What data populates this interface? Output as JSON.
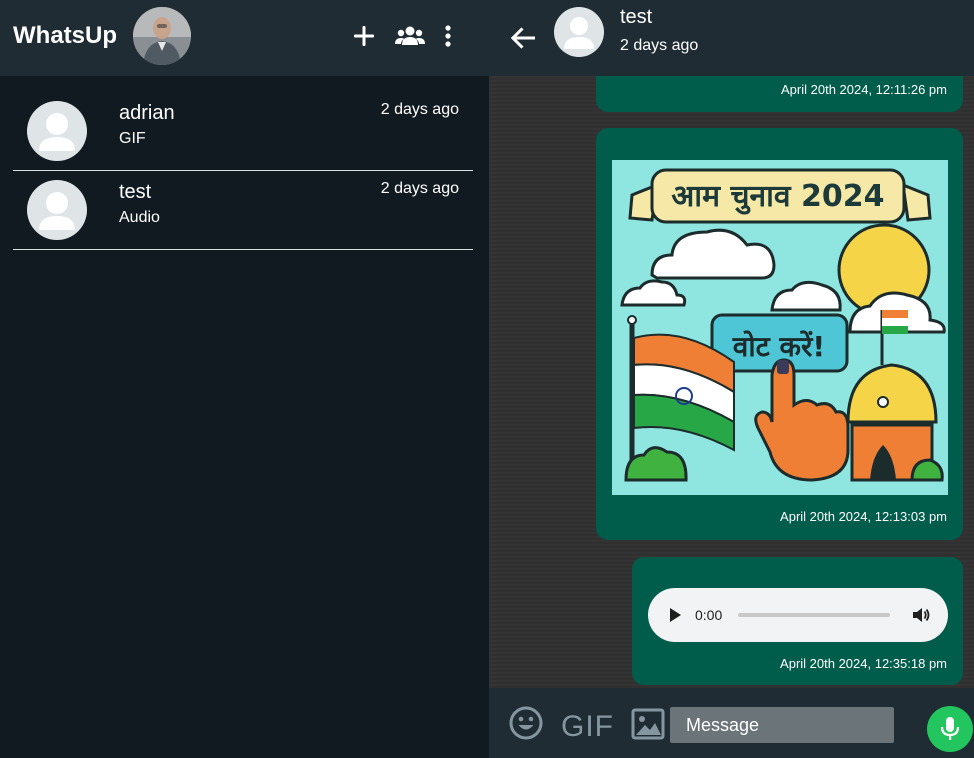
{
  "app": {
    "title": "WhatsUp"
  },
  "header_icons": {
    "new_chat": "plus-icon",
    "new_group": "group-icon",
    "menu": "more-vertical-icon"
  },
  "chats": [
    {
      "name": "adrian",
      "preview": "GIF",
      "time": "2 days ago"
    },
    {
      "name": "test",
      "preview": "Audio",
      "time": "2 days ago"
    }
  ],
  "conversation": {
    "contact_name": "test",
    "contact_status": "2 days ago",
    "messages": [
      {
        "type": "text",
        "timestamp": "April 20th 2024, 12:11:26 pm"
      },
      {
        "type": "image",
        "timestamp": "April 20th 2024, 12:13:03 pm",
        "image": {
          "banner": "आम चुनाव 2024",
          "sign": "वोट करें!"
        }
      },
      {
        "type": "audio",
        "timestamp": "April 20th 2024, 12:35:18 pm",
        "audio": {
          "current_time": "0:00",
          "progress": 0
        }
      }
    ]
  },
  "composer": {
    "gif_label": "GIF",
    "placeholder": "Message",
    "value": ""
  },
  "colors": {
    "sidebar_bg": "#111a21",
    "header_bg": "#202c33",
    "bubble_out": "#005c4b",
    "mic_button": "#22c55e"
  }
}
